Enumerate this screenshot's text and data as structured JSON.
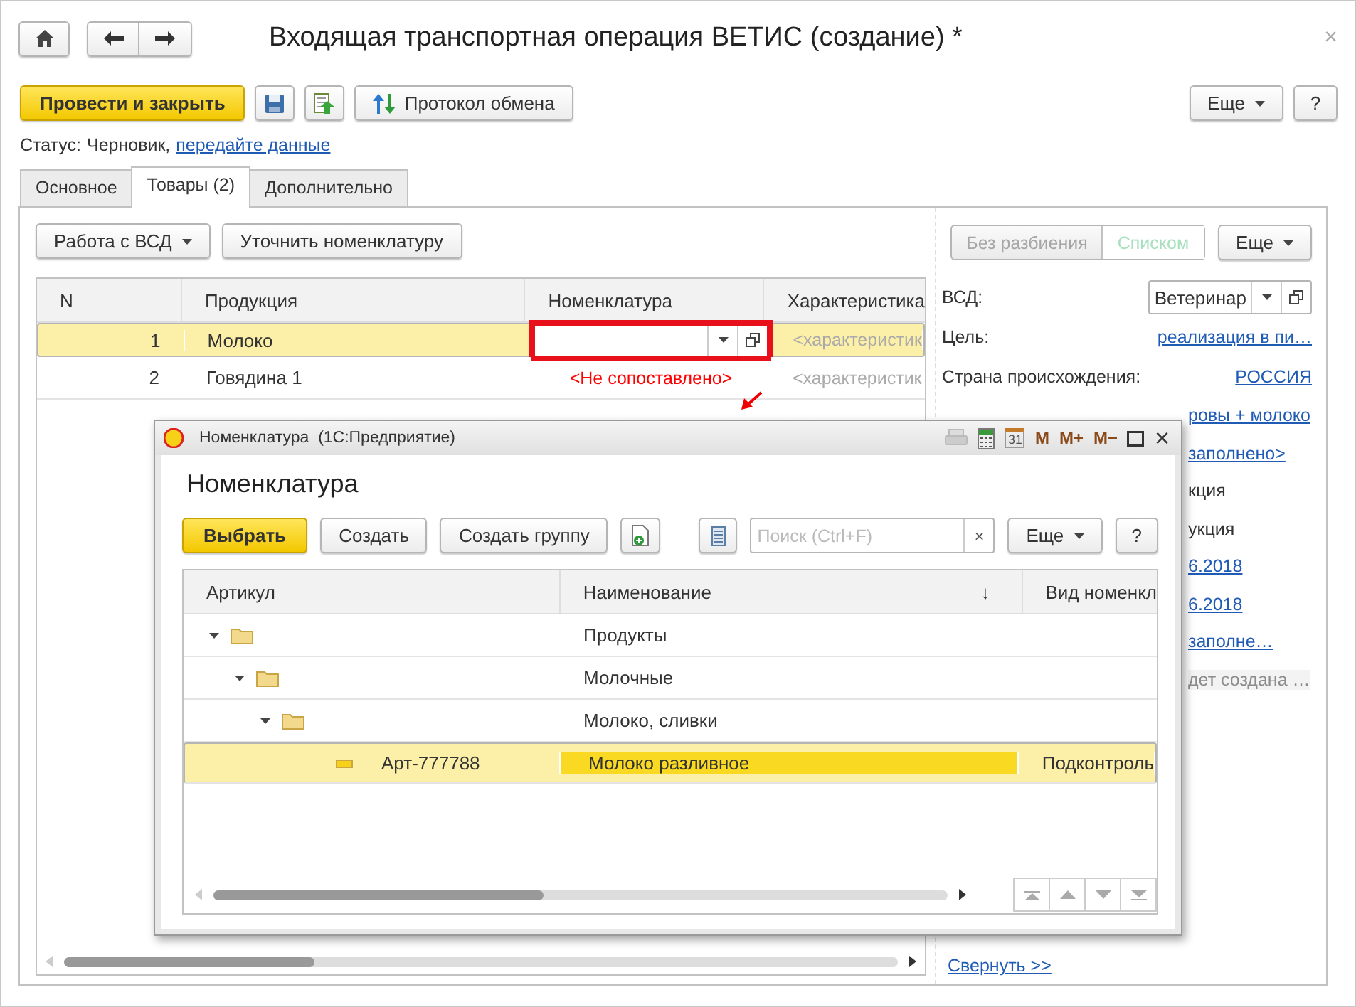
{
  "window": {
    "title": "Входящая транспортная операция ВЕТИС (создание) *",
    "close": "×"
  },
  "toolbar": {
    "primary": "Провести и закрыть",
    "protocol": "Протокол обмена",
    "more": "Еще",
    "help": "?"
  },
  "status": {
    "label": "Статус:",
    "value": "Черновик,",
    "link": "передайте данные"
  },
  "tabs": [
    {
      "label": "Основное",
      "selected": false
    },
    {
      "label": "Товары (2)",
      "selected": true
    },
    {
      "label": "Дополнительно",
      "selected": false
    }
  ],
  "goods": {
    "buttons": [
      "Работа с ВСД",
      "Уточнить номенклатуру"
    ],
    "view_modes": [
      {
        "label": "Без разбиения",
        "selected": false
      },
      {
        "label": "Списком",
        "selected": true
      }
    ],
    "more": "Еще",
    "columns": [
      "N",
      "Продукция",
      "Номенклатура",
      "Характеристика"
    ],
    "rows": [
      {
        "n": "1",
        "product": "Молоко",
        "nomenclature": "",
        "characteristic": "<характеристик",
        "selected": true,
        "kind": "field",
        "highlighted": true
      },
      {
        "n": "2",
        "product": "Говядина 1",
        "nomenclature": "<Не сопоставлено>",
        "characteristic": "<характеристик",
        "selected": false,
        "kind": "text"
      }
    ],
    "details": [
      {
        "label": "ВСД:",
        "kind": "select",
        "value": "Ветеринар"
      },
      {
        "label": "Цель:",
        "kind": "link",
        "value": "реализация в пи…"
      },
      {
        "label": "Страна происхождения:",
        "kind": "link",
        "value": "РОССИЯ"
      }
    ],
    "partly_hidden": [
      {
        "kind": "link",
        "value": "ровы + молоко"
      },
      {
        "kind": "link",
        "value": "заполнено>"
      },
      {
        "kind": "text",
        "value": "кция"
      },
      {
        "kind": "text",
        "value": "укция"
      },
      {
        "kind": "link",
        "value": "6.2018"
      },
      {
        "kind": "link",
        "value": "6.2018"
      },
      {
        "kind": "link",
        "value": "заполне…"
      },
      {
        "kind": "muted",
        "value": "дет создана …"
      }
    ],
    "collapse_link": "Свернуть >>"
  },
  "dialog": {
    "title": "Номенклатура  (1С:Предприятие)",
    "calendar_day": "31",
    "memory": [
      "M",
      "M+",
      "M−"
    ],
    "close": "×",
    "heading": "Номенклатура",
    "buttons": {
      "choose": "Выбрать",
      "create": "Создать",
      "create_group": "Создать группу",
      "more": "Еще",
      "help": "?"
    },
    "search": {
      "placeholder": "Поиск (Ctrl+F)",
      "clear": "×"
    },
    "columns": [
      "Артикул",
      "Наименование",
      "Вид номенкл"
    ],
    "sort_mark": "↓",
    "tree": [
      {
        "kind": "group",
        "name": "Продукты",
        "expanded": true,
        "selected": false,
        "children": [
          {
            "kind": "group",
            "name": "Молочные",
            "expanded": true,
            "selected": false,
            "children": [
              {
                "kind": "group",
                "name": "Молоко, сливки",
                "expanded": true,
                "selected": false,
                "children": [
                  {
                    "kind": "item",
                    "article": "Арт-777788",
                    "name": "Молоко разливное",
                    "column_3": "Подконтроль",
                    "selected": true
                  }
                ]
              }
            ]
          }
        ]
      }
    ]
  }
}
